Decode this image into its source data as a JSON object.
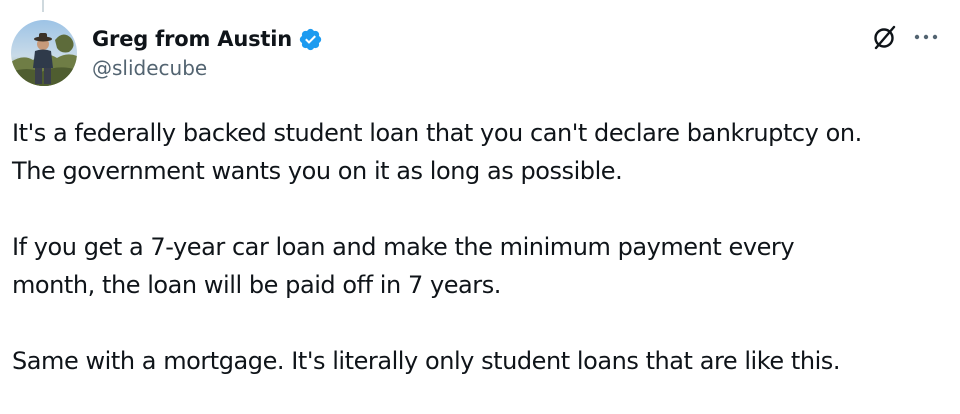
{
  "tweet": {
    "author": {
      "display_name": "Greg from Austin",
      "handle": "@slidecube",
      "verified": true,
      "avatar_icon": "profile-photo"
    },
    "actions": {
      "grok_icon": "slashed-circle-icon",
      "more_icon": "more-horizontal-icon"
    },
    "body": {
      "paragraphs": [
        {
          "lines": [
            "It's a federally backed student loan that you can't declare bankruptcy on.",
            "The government wants you on it as long as possible."
          ]
        },
        {
          "lines": [
            "If you get a 7-year car loan and make the minimum payment every",
            "month, the loan will be paid off in 7 years."
          ]
        },
        {
          "lines": [
            "Same with a mortgage. It's literally only student loans that are like this."
          ]
        }
      ]
    }
  },
  "colors": {
    "text_primary": "#0f1419",
    "text_secondary": "#536471",
    "verified_blue": "#1d9bf0",
    "thread_line": "#cfd9de"
  }
}
